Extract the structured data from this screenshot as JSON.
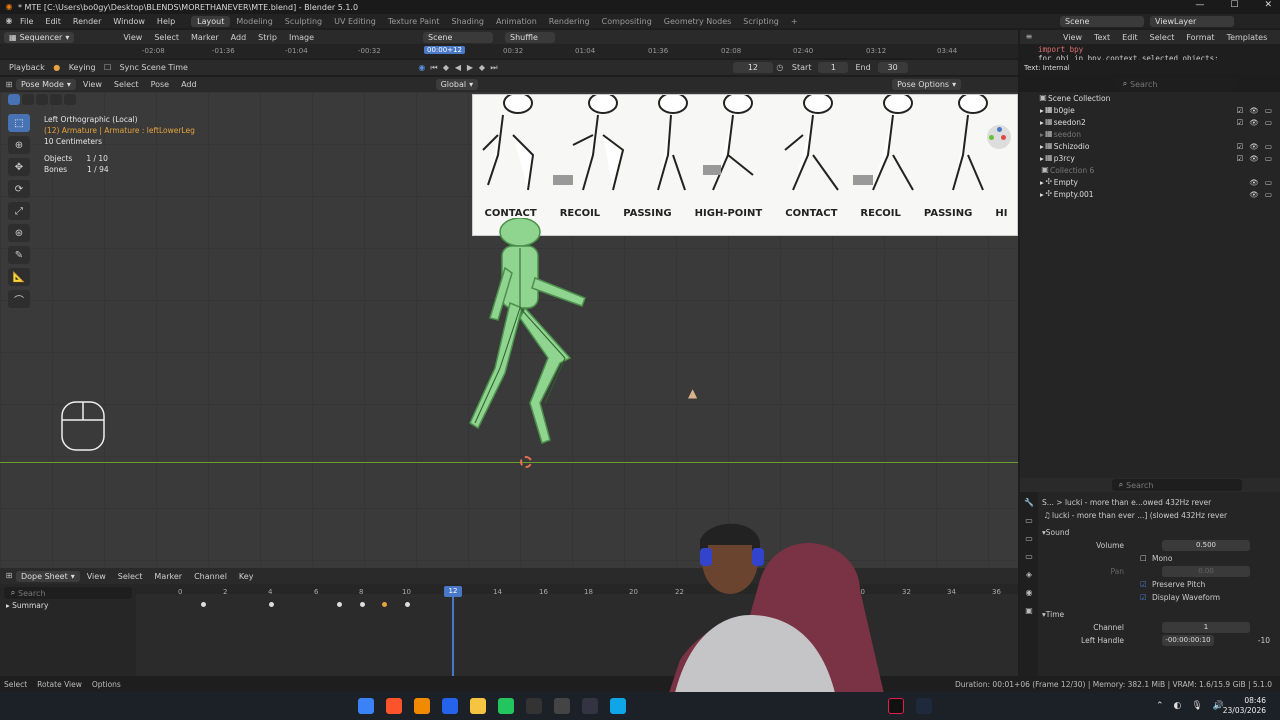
{
  "window": {
    "title": "* MTE [C:\\Users\\bo0gy\\Desktop\\BLENDS\\MORETHANEVER\\MTE.blend] - Blender 5.1.0"
  },
  "menubar": {
    "items": [
      "File",
      "Edit",
      "Render",
      "Window",
      "Help"
    ],
    "workspaces": [
      "Layout",
      "Modeling",
      "Sculpting",
      "UV Editing",
      "Texture Paint",
      "Shading",
      "Animation",
      "Rendering",
      "Compositing",
      "Geometry Nodes",
      "Scripting"
    ],
    "active_workspace": "Layout",
    "scene": "Scene",
    "view_layer": "ViewLayer"
  },
  "sequencer_header": {
    "editor": "Sequencer",
    "menus": [
      "View",
      "Select",
      "Marker",
      "Add",
      "Strip",
      "Image"
    ],
    "scene_field": "Scene",
    "shuffle": "Shuffle",
    "timecodes": [
      "-02:08",
      "-01:36",
      "-01:04",
      "-00:32",
      "00:00+12",
      "00:32",
      "01:04",
      "01:36",
      "02:08",
      "02:40",
      "03:12",
      "03:44"
    ],
    "current_timecode": "00:00+12"
  },
  "text_editor": {
    "menus": [
      "View",
      "Text",
      "Edit",
      "Select",
      "Format",
      "Templates"
    ],
    "code_line1": "import bpy",
    "code_line2": "for obj in bpy.context.selected_objects:",
    "status": "Text: Internal"
  },
  "playback_header": {
    "playback": "Playback",
    "keying": "Keying",
    "sync": "Sync Scene Time",
    "frame": "12",
    "start_label": "Start",
    "start": "1",
    "end_label": "End",
    "end": "30"
  },
  "viewport_header": {
    "mode": "Pose Mode",
    "menus": [
      "View",
      "Select",
      "Pose",
      "Add"
    ],
    "orientation": "Global",
    "pose_options": "Pose Options"
  },
  "viewport_info": {
    "view": "Left Orthographic (Local)",
    "armature": "(12) Armature | Armature : leftLowerLeg",
    "scale": "10 Centimeters",
    "objects_label": "Objects",
    "objects_value": "1 / 10",
    "bones_label": "Bones",
    "bones_value": "1 / 94"
  },
  "reference_image": {
    "poses": [
      "CONTACT",
      "RECOIL",
      "PASSING",
      "HIGH-POINT",
      "CONTACT",
      "RECOIL",
      "PASSING",
      "HI"
    ]
  },
  "outliner": {
    "search_placeholder": "Search",
    "collection": "Scene Collection",
    "items": [
      {
        "name": "b0gie"
      },
      {
        "name": "seedon2"
      },
      {
        "name": "seedon"
      },
      {
        "name": "Schizodio"
      },
      {
        "name": "p3rcy"
      },
      {
        "name": "Collection 6"
      },
      {
        "name": "Empty"
      },
      {
        "name": "Empty.001"
      }
    ]
  },
  "properties": {
    "search_placeholder": "Search",
    "breadcrumb": "S... > lucki - more than e...owed 432Hz  rever",
    "strip_name": "lucki - more than ever ...] (slowed 432Hz  rever",
    "sound_panel": "Sound",
    "volume_label": "Volume",
    "volume_value": "0.500",
    "mono_label": "Mono",
    "pan_label": "Pan",
    "pan_value": "0.00",
    "preserve_pitch": "Preserve Pitch",
    "display_waveform": "Display Waveform",
    "time_panel": "Time",
    "channel_label": "Channel",
    "channel_value": "1",
    "left_handle_label": "Left Handle",
    "left_handle_value": "-00:00:00:10",
    "left_handle_frames": "-10"
  },
  "dopesheet": {
    "editor": "Dope Sheet",
    "menus": [
      "View",
      "Select",
      "Marker",
      "Channel",
      "Key"
    ],
    "search_placeholder": "Search",
    "summary": "Summary",
    "frame_labels": [
      "0",
      "2",
      "4",
      "6",
      "8",
      "10",
      "12",
      "14",
      "16",
      "18",
      "20",
      "22",
      "30",
      "32",
      "34",
      "36"
    ],
    "current_frame": "12",
    "keyframes": [
      1,
      4,
      7,
      8,
      9,
      10
    ],
    "selected_keyframes": [
      9
    ]
  },
  "statusbar": {
    "select": "Select",
    "rotate": "Rotate View",
    "options": "Options",
    "info": "Duration: 00:01+06 (Frame 12/30) | Memory: 382.1 MiB | VRAM: 1.6/15.9 GiB | 5.1.0"
  },
  "taskbar": {
    "time": "08:46",
    "date": "23/03/2026"
  },
  "colors": {
    "accent": "#4772b3",
    "selected_key": "#e6a33e",
    "armature": "#7bd17b"
  }
}
